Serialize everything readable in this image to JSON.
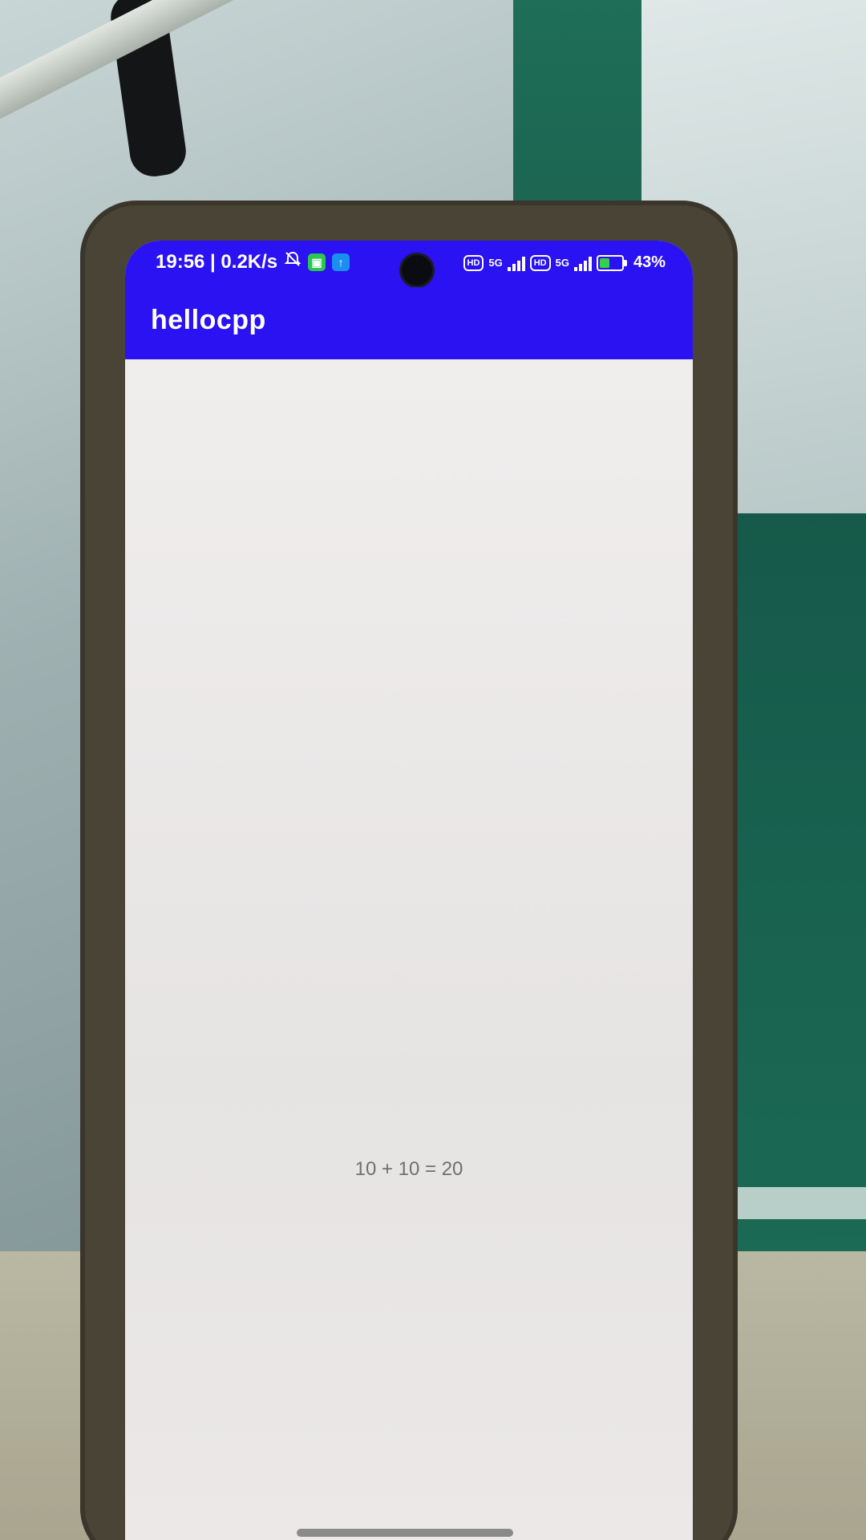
{
  "status_bar": {
    "time_speed": "19:56 | 0.2K/s",
    "hd_label": "HD",
    "network_label": "5G",
    "battery_percent": "43%"
  },
  "app_bar": {
    "title": "hellocpp"
  },
  "main": {
    "result": "10 + 10 = 20"
  },
  "colors": {
    "app_bar": "#2a12f2",
    "content_background": "#ebe8e7",
    "result_text": "#6f6f6f"
  },
  "icons": [
    "mute-bell-icon",
    "app-notification-icon",
    "upload-notification-icon",
    "signal-icon",
    "battery-icon"
  ]
}
